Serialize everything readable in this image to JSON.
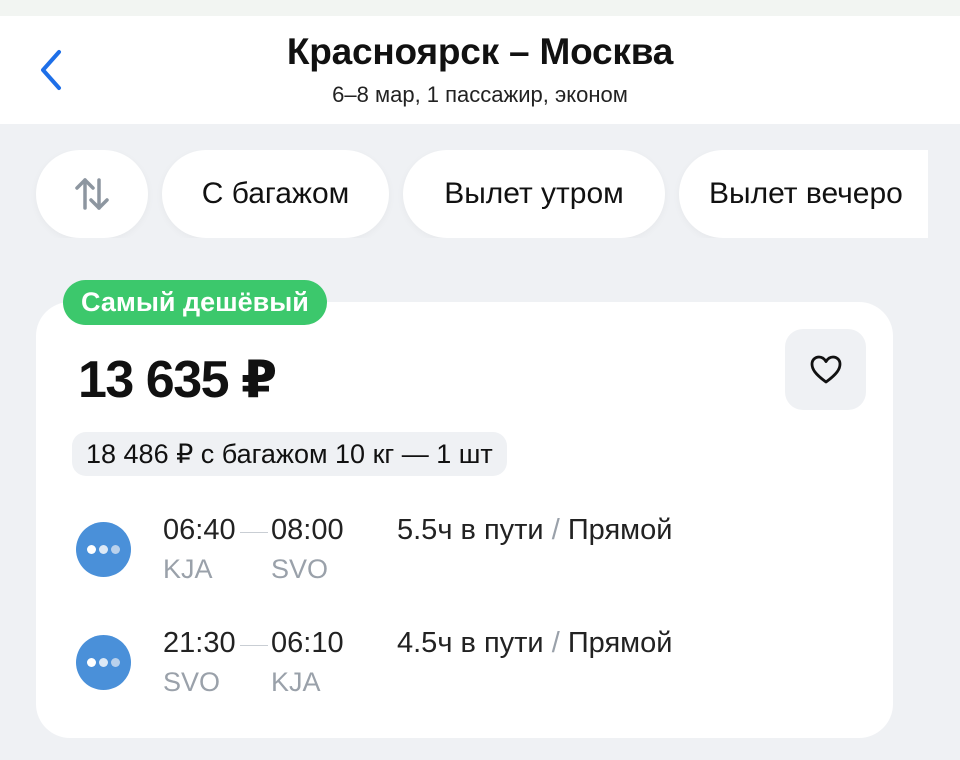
{
  "header": {
    "title": "Красноярск – Москва",
    "subtitle": "6–8 мар, 1 пассажир, эконом"
  },
  "filters": {
    "chips": [
      "С багажом",
      "Вылет утром",
      "Вылет вечеро"
    ]
  },
  "ticket": {
    "badge": "Самый дешёвый",
    "price": "13 635 ₽",
    "baggage_offer": "18 486 ₽ с багажом 10 кг — 1 шт",
    "segments": [
      {
        "departure_time": "06:40",
        "arrival_time": "08:00",
        "from": "KJA",
        "to": "SVO",
        "duration": "5.5ч в пути",
        "separator": "/",
        "type": "Прямой"
      },
      {
        "departure_time": "21:30",
        "arrival_time": "06:10",
        "from": "SVO",
        "to": "KJA",
        "duration": "4.5ч в пути",
        "separator": "/",
        "type": "Прямой"
      }
    ]
  },
  "colors": {
    "accent": "#1e6fe8",
    "badge": "#3cc86c",
    "airline_logo": "#4a90d9",
    "background": "#eff1f4"
  },
  "icons": {
    "back": "chevron-left-icon",
    "sort": "sort-arrows-icon",
    "favorite": "heart-outline-icon"
  }
}
